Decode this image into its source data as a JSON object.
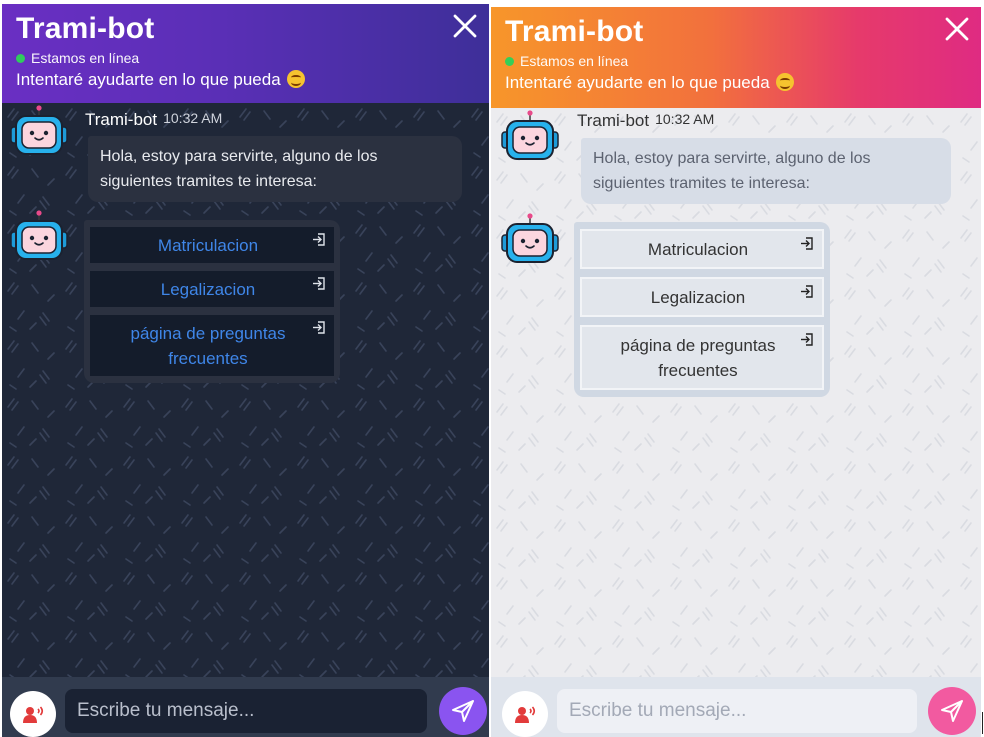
{
  "bot_name": "Trami-bot",
  "online_status": "Estamos en línea",
  "subtitle": "Intentaré ayudarte en lo que pueda",
  "message": {
    "author": "Trami-bot",
    "time": "10:32 AM",
    "text": "Hola, estoy para servirte, alguno de los siguientes tramites te interesa:"
  },
  "options": [
    "Matriculacion",
    "Legalizacion",
    "página de preguntas frecuentes"
  ],
  "input": {
    "placeholder": "Escribe tu mensaje..."
  },
  "icons": {
    "close": "close-icon",
    "emoji": "smiling-face-icon",
    "avatar": "robot-icon",
    "option": "login-icon",
    "voice": "voice-icon",
    "send": "send-icon"
  },
  "themes": {
    "dark": {
      "header_gradient": [
        "#6a2fc3",
        "#3e2f99"
      ],
      "chat_bg": "#1f2738",
      "send_button": "#8a54f0",
      "option_text": "#3f86e8"
    },
    "light": {
      "header_gradient": [
        "#f7962a",
        "#df2b82"
      ],
      "chat_bg": "#ececef",
      "send_button": "#f25aa0",
      "option_text": "#333333"
    }
  }
}
